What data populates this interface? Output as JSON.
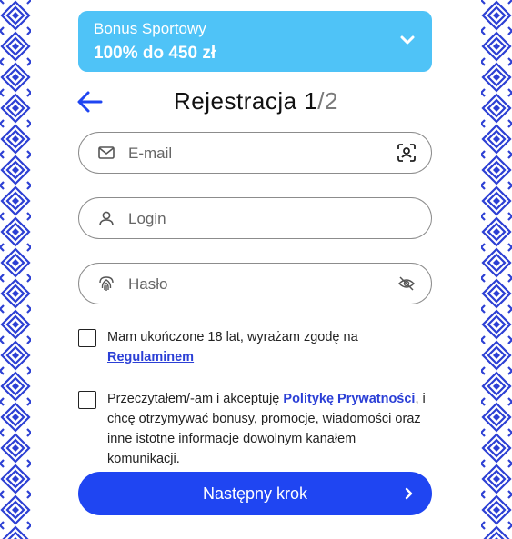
{
  "bonus": {
    "label": "Bonus Sportowy",
    "offer": "100% do 450 zł"
  },
  "header": {
    "title": "Rejestracja",
    "step_current": "1",
    "step_sep": "/",
    "step_total": "2"
  },
  "fields": {
    "email": {
      "placeholder": "E-mail",
      "value": ""
    },
    "login": {
      "placeholder": "Login",
      "value": ""
    },
    "password": {
      "placeholder": "Hasło",
      "value": ""
    }
  },
  "consents": {
    "age": {
      "text": "Mam ukończone 18 lat, wyrażam zgodę na",
      "link": "Regulaminem"
    },
    "privacy": {
      "text_before": "Przeczytałem/-am i akceptuję ",
      "link": "Politykę Prywatności",
      "text_after": ", i chcę otrzymywać bonusy, promocje, wiadomości oraz inne istotne informacje dowolnym kanałem komunikacji."
    }
  },
  "cta": {
    "label": "Następny krok"
  },
  "colors": {
    "bonus_bg": "#4fc3f7",
    "primary": "#1f45f2",
    "link": "#2b3fd6",
    "pattern": "#2c3fd4"
  },
  "icons": {
    "back": "arrow-left-icon",
    "dropdown": "chevron-down-icon",
    "email": "envelope-icon",
    "scan": "face-scan-icon",
    "login": "user-icon",
    "password": "fingerprint-icon",
    "toggle": "eye-off-icon",
    "next": "chevron-right-icon"
  }
}
